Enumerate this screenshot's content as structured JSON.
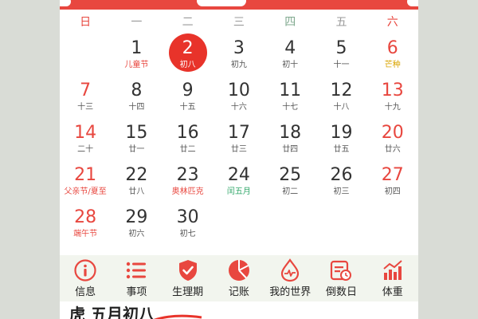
{
  "weekdays": [
    "日",
    "一",
    "二",
    "三",
    "四",
    "五",
    "六"
  ],
  "days": [
    {
      "num": "",
      "sub": ""
    },
    {
      "num": "1",
      "sub": "儿童节",
      "style": "festival"
    },
    {
      "num": "2",
      "sub": "初八",
      "today": true
    },
    {
      "num": "3",
      "sub": "初九"
    },
    {
      "num": "4",
      "sub": "初十"
    },
    {
      "num": "5",
      "sub": "十一"
    },
    {
      "num": "6",
      "sub": "芒种",
      "style": "term",
      "weekend": true
    },
    {
      "num": "7",
      "sub": "十三",
      "weekend": true
    },
    {
      "num": "8",
      "sub": "十四"
    },
    {
      "num": "9",
      "sub": "十五"
    },
    {
      "num": "10",
      "sub": "十六"
    },
    {
      "num": "11",
      "sub": "十七"
    },
    {
      "num": "12",
      "sub": "十八"
    },
    {
      "num": "13",
      "sub": "十九",
      "weekend": true
    },
    {
      "num": "14",
      "sub": "二十",
      "weekend": true
    },
    {
      "num": "15",
      "sub": "廿一"
    },
    {
      "num": "16",
      "sub": "廿二"
    },
    {
      "num": "17",
      "sub": "廿三"
    },
    {
      "num": "18",
      "sub": "廿四"
    },
    {
      "num": "19",
      "sub": "廿五"
    },
    {
      "num": "20",
      "sub": "廿六",
      "weekend": true
    },
    {
      "num": "21",
      "sub": "父亲节/夏至",
      "style": "festival",
      "weekend": true
    },
    {
      "num": "22",
      "sub": "廿八"
    },
    {
      "num": "23",
      "sub": "奥林匹克",
      "style": "festival"
    },
    {
      "num": "24",
      "sub": "闰五月",
      "style": "green"
    },
    {
      "num": "25",
      "sub": "初二"
    },
    {
      "num": "26",
      "sub": "初三"
    },
    {
      "num": "27",
      "sub": "初四",
      "weekend": true
    },
    {
      "num": "28",
      "sub": "端午节",
      "style": "festival",
      "weekend": true
    },
    {
      "num": "29",
      "sub": "初六"
    },
    {
      "num": "30",
      "sub": "初七"
    }
  ],
  "toolbar": [
    {
      "name": "info",
      "label": "信息",
      "icon": "info-icon"
    },
    {
      "name": "events",
      "label": "事项",
      "icon": "list-icon"
    },
    {
      "name": "period",
      "label": "生理期",
      "icon": "shield-check-icon"
    },
    {
      "name": "bookkeeping",
      "label": "记账",
      "icon": "pie-chart-icon"
    },
    {
      "name": "my-world",
      "label": "我的世界",
      "icon": "drop-pulse-icon"
    },
    {
      "name": "countdown",
      "label": "倒数日",
      "icon": "calendar-clock-icon"
    },
    {
      "name": "weight",
      "label": "体重",
      "icon": "bar-chart-icon"
    }
  ],
  "bottom": {
    "lunar_text": "虎 五月初八"
  },
  "colors": {
    "accent": "#e8473f",
    "today": "#e8332a",
    "term": "#d9a400",
    "green": "#33a86b",
    "toolbar_bg": "#f2f5ee"
  }
}
